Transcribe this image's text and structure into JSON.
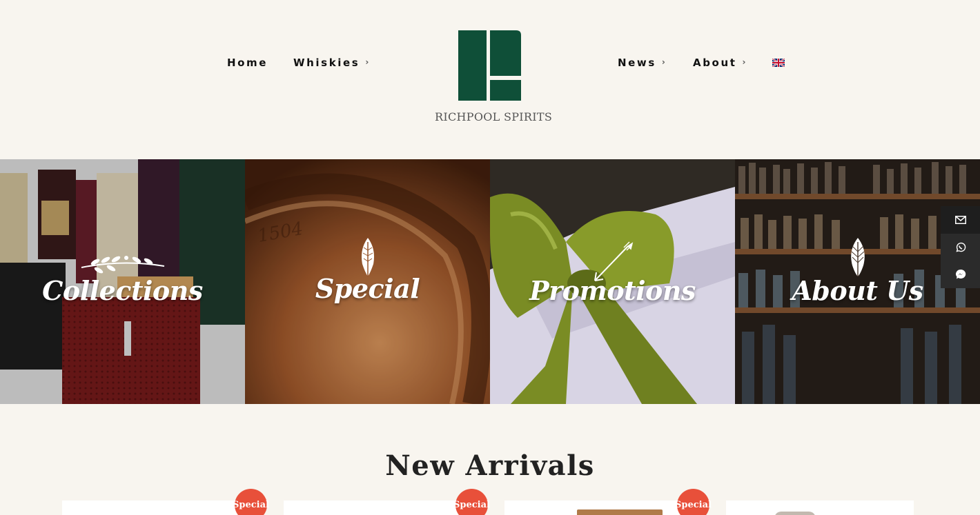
{
  "nav": {
    "home": "Home",
    "whiskies": "Whiskies",
    "news": "News",
    "about": "About",
    "chevron": "›",
    "language_icon": "uk-flag-icon"
  },
  "brand": {
    "name": "RICHPOOL SPIRITS",
    "color": "#0f4f38"
  },
  "tiles": [
    {
      "label": "Collections",
      "ornament": "laurel-branch-icon"
    },
    {
      "label": "Special",
      "ornament": "feather-icon"
    },
    {
      "label": "Promotions",
      "ornament": "arrow-icon"
    },
    {
      "label": "About Us",
      "ornament": "leaf-icon"
    }
  ],
  "contact": [
    "envelope-icon",
    "whatsapp-icon",
    "messenger-icon"
  ],
  "section": {
    "title": "New Arrivals"
  },
  "badges": [
    "Special",
    "Special",
    "Special"
  ],
  "colors": {
    "background": "#f8f5ef",
    "badge": "#e8503a",
    "contact_bar": "#2b2b2b"
  }
}
